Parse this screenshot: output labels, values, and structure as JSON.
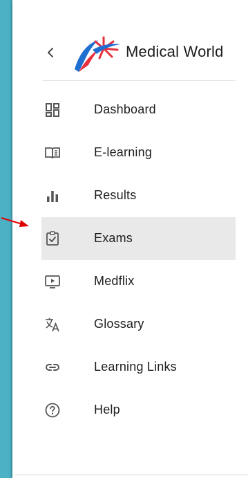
{
  "colors": {
    "background": "#4db1c6",
    "sidebar": "#ffffff",
    "active_item": "#e9e9e9",
    "text": "#1e1e1e",
    "icon": "#555555",
    "logo_blue": "#1f6fd1",
    "logo_red": "#e6303e",
    "arrow": "#e00000"
  },
  "brand": {
    "name": "Medical World",
    "back_icon": "chevron-left-icon",
    "logo_icon": "medical-world-logo"
  },
  "nav": {
    "items": [
      {
        "label": "Dashboard",
        "icon": "dashboard-icon",
        "active": false
      },
      {
        "label": "E-learning",
        "icon": "book-open-icon",
        "active": false
      },
      {
        "label": "Results",
        "icon": "bar-chart-icon",
        "active": false
      },
      {
        "label": "Exams",
        "icon": "clipboard-check-icon",
        "active": true
      },
      {
        "label": "Medflix",
        "icon": "video-play-icon",
        "active": false
      },
      {
        "label": "Glossary",
        "icon": "translate-icon",
        "active": false
      },
      {
        "label": "Learning Links",
        "icon": "link-icon",
        "active": false
      },
      {
        "label": "Help",
        "icon": "help-circle-icon",
        "active": false
      }
    ]
  },
  "annotation": {
    "icon": "red-arrow-pointer",
    "points_to": "Exams"
  }
}
